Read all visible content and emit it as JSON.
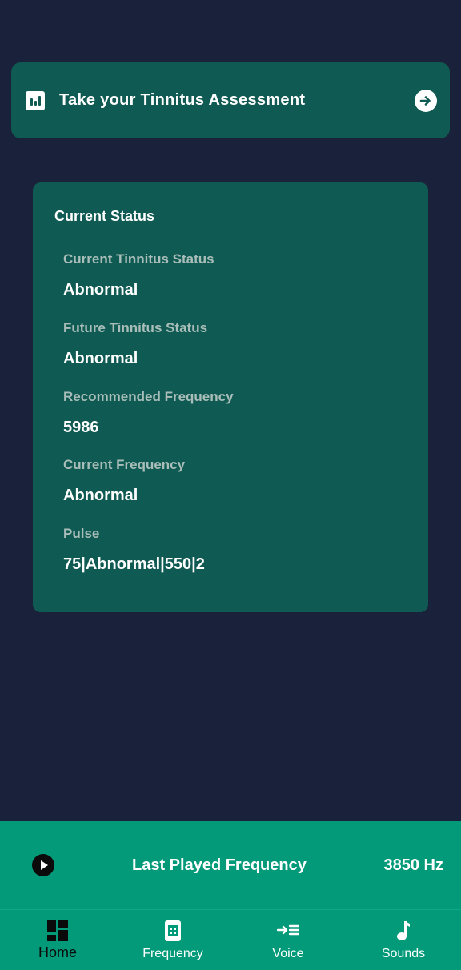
{
  "assessment": {
    "title": "Take your Tinnitus Assessment",
    "icon": "bar-chart-icon",
    "action_icon": "arrow-right-circle-icon"
  },
  "status_card": {
    "heading": "Current Status",
    "items": [
      {
        "label": "Current Tinnitus Status",
        "value": "Abnormal"
      },
      {
        "label": "Future Tinnitus Status",
        "value": "Abnormal"
      },
      {
        "label": "Recommended Frequency",
        "value": "5986"
      },
      {
        "label": "Current Frequency",
        "value": "Abnormal"
      },
      {
        "label": "Pulse",
        "value": "75|Abnormal|550|2"
      }
    ]
  },
  "player": {
    "icon": "play-icon",
    "title": "Last Played Frequency",
    "value": "3850 Hz"
  },
  "nav": {
    "items": [
      {
        "label": "Home",
        "icon": "dashboard-icon",
        "active": true
      },
      {
        "label": "Frequency",
        "icon": "frequency-icon",
        "active": false
      },
      {
        "label": "Voice",
        "icon": "voice-icon",
        "active": false
      },
      {
        "label": "Sounds",
        "icon": "music-note-icon",
        "active": false
      }
    ]
  },
  "colors": {
    "background": "#19223a",
    "card": "#0f5a52",
    "accent": "#029a79",
    "muted_label": "#a9bdb9"
  }
}
